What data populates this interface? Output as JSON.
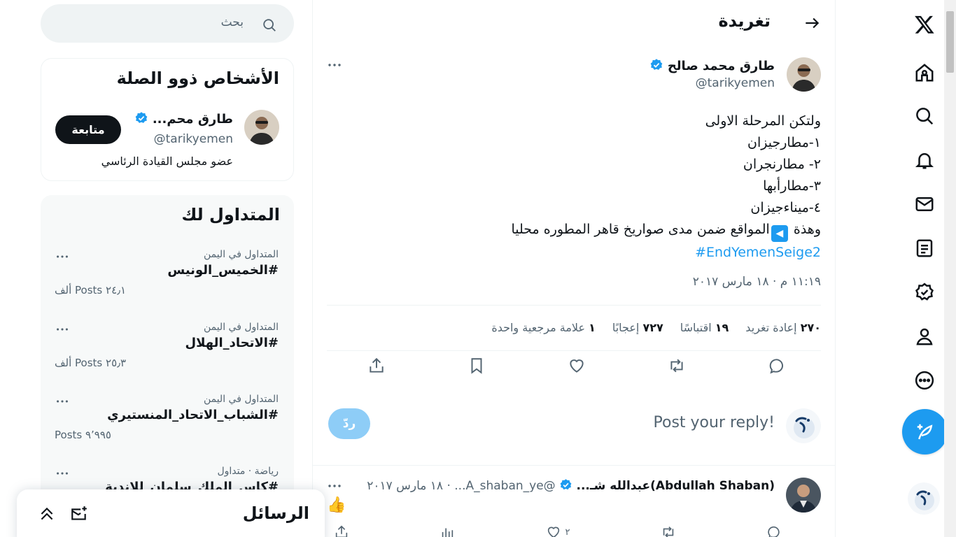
{
  "header": {
    "title": "تغريدة"
  },
  "post": {
    "author_name": "طارق محمد صالح",
    "author_handle": "@tarikyemen",
    "lines": [
      "ولتكن المرحلة الاولى",
      "١-مطارجيزان",
      "٢- مطارنجران",
      "٣-مطارأبها",
      "٤-ميناءجيزان"
    ],
    "line_last_prefix": "وهذة",
    "line_last_suffix": "المواقع ضمن مدى صواريخ قاهر المطوره محليا",
    "hashtag": "#EndYemenSeige2",
    "timestamp": "١١:١٩ م · ١٨ مارس ٢٠١٧",
    "stats": {
      "retweets_num": "٢٧٠",
      "retweets_label": "إعادة تغريد",
      "quotes_num": "١٩",
      "quotes_label": "اقتباسًا",
      "likes_num": "٧٢٧",
      "likes_label": "إعجابًا",
      "bookmarks_num": "١",
      "bookmarks_label": "علامة مرجعية واحدة"
    }
  },
  "reply": {
    "placeholder": "Post your reply!",
    "button": "ردّ"
  },
  "comment": {
    "name": "(Abdullah Shaban)عبدالله شـ...",
    "meta": "@A_shaban_ye... · ١٨ مارس ٢٠١٧",
    "emoji": "👍",
    "likes": "٢"
  },
  "search": {
    "placeholder": "بحث"
  },
  "people": {
    "title": "الأشخاص ذوو الصلة",
    "name": "طارق محم...",
    "handle": "@tarikyemen",
    "bio": "عضو مجلس القيادة الرئاسي",
    "follow": "متابعة"
  },
  "trends": {
    "title": "المتداول لك",
    "items": [
      {
        "context": "المتداول في اليمن",
        "name": "#الخميس_الونيس",
        "count": "٢٤٫١ Posts ألف"
      },
      {
        "context": "المتداول في اليمن",
        "name": "#الاتحاد_الهلال",
        "count": "٢٥٫٣ Posts ألف"
      },
      {
        "context": "المتداول في اليمن",
        "name": "#الشباب_الاتحاد_المنستيري",
        "count": "٩٬٩٩٥ Posts"
      },
      {
        "context": "رياضة · متداول",
        "name": "#كاس_الملك_سلمان_للاندية",
        "count": ""
      }
    ]
  },
  "messages": {
    "title": "الرسائل"
  },
  "colors": {
    "accent": "#1d9bf0",
    "text": "#0f1419",
    "muted": "#536471",
    "border": "#eff3f4"
  }
}
